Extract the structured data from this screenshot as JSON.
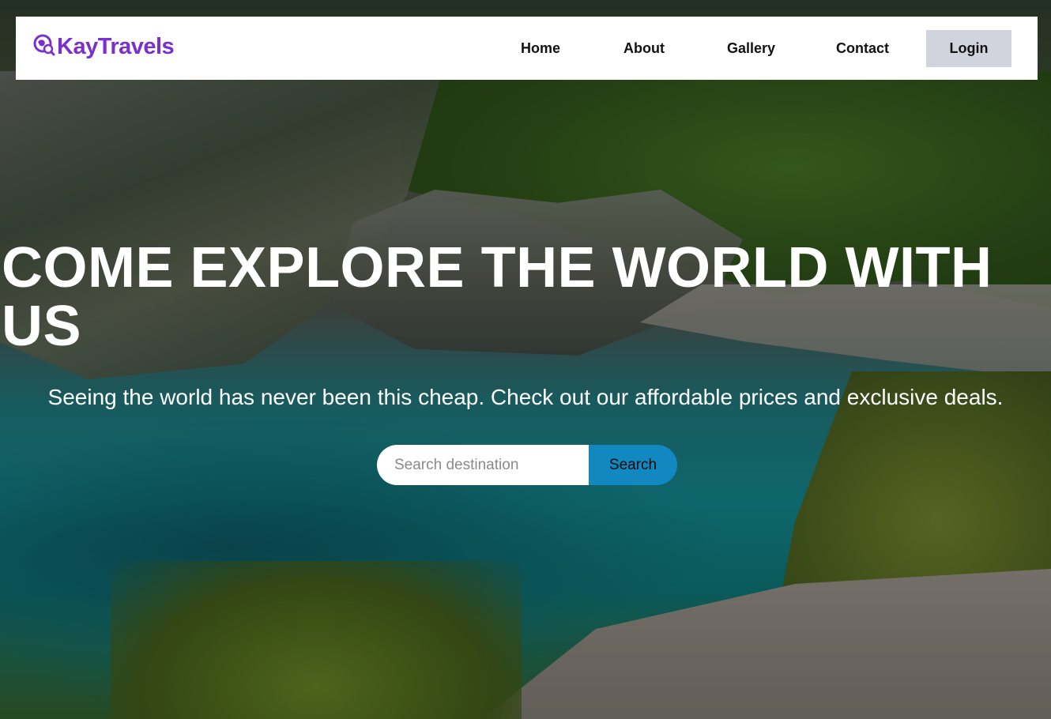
{
  "brand": {
    "name": "KayTravels",
    "icon": "globe-search-icon",
    "color": "#7b2fd0"
  },
  "nav": {
    "items": [
      {
        "label": "Home"
      },
      {
        "label": "About"
      },
      {
        "label": "Gallery"
      },
      {
        "label": "Contact"
      }
    ],
    "login_label": "Login"
  },
  "hero": {
    "headline": "COME EXPLORE THE WORLD WITH US",
    "subtitle": "Seeing the world has never been this cheap. Check out our affordable prices and exclusive deals.",
    "background": "beach-cove-photo"
  },
  "search": {
    "placeholder": "Search destination",
    "value": "",
    "button_label": "Search",
    "button_color": "#1189c0"
  }
}
